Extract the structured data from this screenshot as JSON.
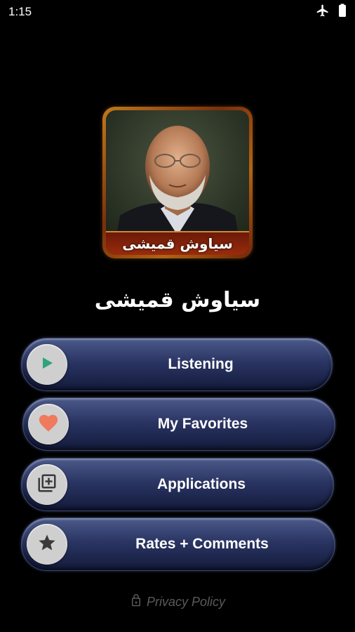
{
  "status_bar": {
    "time": "1:15",
    "icons": [
      "airplane-mode-icon",
      "battery-icon"
    ]
  },
  "cover": {
    "banner_text": "سیاوش قمیشی"
  },
  "app_title": "سیاوش قمیشی",
  "menu": {
    "items": [
      {
        "label": "Listening",
        "icon": "play-icon"
      },
      {
        "label": "My Favorites",
        "icon": "heart-icon"
      },
      {
        "label": "Applications",
        "icon": "add-library-icon"
      },
      {
        "label": "Rates + Comments",
        "icon": "star-icon"
      }
    ]
  },
  "footer": {
    "privacy_label": "Privacy Policy",
    "icon": "lock-icon"
  },
  "colors": {
    "background": "#000000",
    "button_top": "#4c5a8a",
    "button_bottom": "#131a3b",
    "play_green": "#2fa37f",
    "heart_salmon": "#ef7a5e",
    "icon_circle": "#cfcfcf",
    "privacy_gray": "#5a5a5a",
    "cover_frame": "#c2791c"
  }
}
